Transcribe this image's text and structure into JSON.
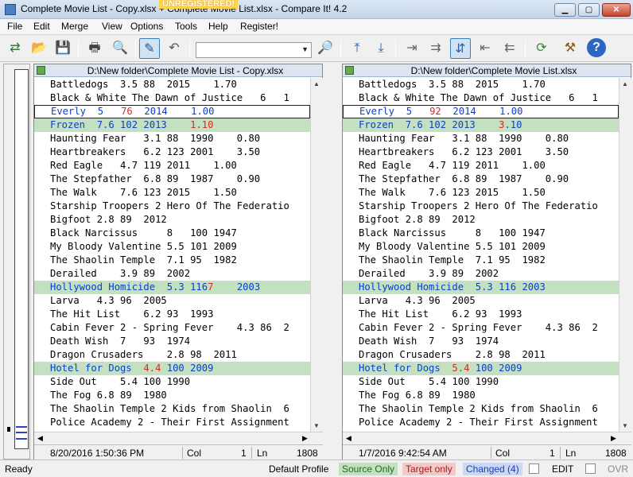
{
  "window": {
    "title": "Complete Movie List - Copy.xlsx + Complete Movie List.xlsx - Compare It! 4.2",
    "unregistered": "UNREGISTERED!",
    "min_glyph": "▁",
    "max_glyph": "▢",
    "close_glyph": "✕"
  },
  "menu": [
    "File",
    "Edit",
    "Merge",
    "View",
    "Options",
    "Tools",
    "Help",
    "Register!"
  ],
  "toolbar": {
    "search_value": "",
    "combo_arrow": "▼",
    "buttons": [
      {
        "icon": "compare-icon",
        "glyph": "⇄"
      },
      {
        "icon": "open-folder-icon",
        "glyph": "📂"
      },
      {
        "icon": "save-icon",
        "glyph": "💾"
      },
      {
        "icon": "print-icon",
        "glyph": "🖶"
      },
      {
        "icon": "print-preview-icon",
        "glyph": "🔍"
      },
      {
        "icon": "edit-pencil-icon",
        "glyph": "✎"
      },
      {
        "icon": "undo-icon",
        "glyph": "↶"
      },
      {
        "icon": "find-icon",
        "glyph": "🔎"
      },
      {
        "icon": "first-change-icon",
        "glyph": "⤒"
      },
      {
        "icon": "last-change-icon",
        "glyph": "⤓"
      },
      {
        "icon": "copy-right-icon",
        "glyph": "⇥"
      },
      {
        "icon": "copy-all-right-icon",
        "glyph": "⇉"
      },
      {
        "icon": "next-change-icon",
        "glyph": "⇵"
      },
      {
        "icon": "copy-left-icon",
        "glyph": "⇤"
      },
      {
        "icon": "copy-all-left-icon",
        "glyph": "⇇"
      },
      {
        "icon": "refresh-icon",
        "glyph": "⟳"
      },
      {
        "icon": "tools-icon",
        "glyph": "⚒"
      },
      {
        "icon": "help-icon",
        "glyph": "?"
      }
    ]
  },
  "overview": {
    "marks": [
      0.94,
      0.955,
      0.97
    ]
  },
  "left_pane": {
    "path": "D:\\New folder\\Complete Movie List - Copy.xlsx",
    "status": {
      "date": "8/20/2016 1:50:36 PM",
      "col_label": "Col",
      "col": "1",
      "ln_label": "Ln",
      "ln": "1808"
    },
    "lines": [
      {
        "segments": [
          {
            "text": "Battledogs  3.5 88  2015    1.70",
            "diff": false
          }
        ],
        "state": "normal"
      },
      {
        "segments": [
          {
            "text": "Black & White The Dawn of Justice   6   1",
            "diff": false
          }
        ],
        "state": "normal"
      },
      {
        "segments": [
          {
            "text": "Everly  5   ",
            "diff": false
          },
          {
            "text": "76",
            "diff": true
          },
          {
            "text": "  2014    1.00",
            "diff": false
          }
        ],
        "state": "focused"
      },
      {
        "segments": [
          {
            "text": "Frozen  7.6 102 2013    ",
            "diff": false
          },
          {
            "text": "1.10",
            "diff": true
          }
        ],
        "state": "changed"
      },
      {
        "segments": [
          {
            "text": "Haunting Fear   3.1 88  1990    0.80",
            "diff": false
          }
        ],
        "state": "normal"
      },
      {
        "segments": [
          {
            "text": "Heartbreakers   6.2 123 2001    3.50",
            "diff": false
          }
        ],
        "state": "normal"
      },
      {
        "segments": [
          {
            "text": "Red Eagle   4.7 119 2011    1.00",
            "diff": false
          }
        ],
        "state": "normal"
      },
      {
        "segments": [
          {
            "text": "The Stepfather  6.8 89  1987    0.90",
            "diff": false
          }
        ],
        "state": "normal"
      },
      {
        "segments": [
          {
            "text": "The Walk    7.6 123 2015    1.50",
            "diff": false
          }
        ],
        "state": "normal"
      },
      {
        "segments": [
          {
            "text": "Starship Troopers 2 Hero Of The Federatio",
            "diff": false
          }
        ],
        "state": "normal"
      },
      {
        "segments": [
          {
            "text": "Bigfoot 2.8 89  2012",
            "diff": false
          }
        ],
        "state": "normal"
      },
      {
        "segments": [
          {
            "text": "Black Narcissus     8   100 1947",
            "diff": false
          }
        ],
        "state": "normal"
      },
      {
        "segments": [
          {
            "text": "My Bloody Valentine 5.5 101 2009",
            "diff": false
          }
        ],
        "state": "normal"
      },
      {
        "segments": [
          {
            "text": "The Shaolin Temple  7.1 95  1982",
            "diff": false
          }
        ],
        "state": "normal"
      },
      {
        "segments": [
          {
            "text": "Derailed    3.9 89  2002",
            "diff": false
          }
        ],
        "state": "normal"
      },
      {
        "segments": [
          {
            "text": "Hollywood Homicide  5.3 116",
            "diff": false
          },
          {
            "text": "7",
            "diff": true
          },
          {
            "text": "    2003",
            "diff": false
          }
        ],
        "state": "changed"
      },
      {
        "segments": [
          {
            "text": "Larva   4.3 96  2005",
            "diff": false
          }
        ],
        "state": "normal"
      },
      {
        "segments": [
          {
            "text": "The Hit List    6.2 93  1993",
            "diff": false
          }
        ],
        "state": "normal"
      },
      {
        "segments": [
          {
            "text": "Cabin Fever 2 - Spring Fever    4.3 86  2",
            "diff": false
          }
        ],
        "state": "normal"
      },
      {
        "segments": [
          {
            "text": "Death Wish  7   93  1974",
            "diff": false
          }
        ],
        "state": "normal"
      },
      {
        "segments": [
          {
            "text": "Dragon Crusaders    2.8 98  2011",
            "diff": false
          }
        ],
        "state": "normal"
      },
      {
        "segments": [
          {
            "text": "Hotel for Dogs  ",
            "diff": false
          },
          {
            "text": "4.4",
            "diff": true
          },
          {
            "text": " 100 2009",
            "diff": false
          }
        ],
        "state": "changed"
      },
      {
        "segments": [
          {
            "text": "Side Out    5.4 100 1990",
            "diff": false
          }
        ],
        "state": "normal"
      },
      {
        "segments": [
          {
            "text": "The Fog 6.8 89  1980",
            "diff": false
          }
        ],
        "state": "normal"
      },
      {
        "segments": [
          {
            "text": "The Shaolin Temple 2 Kids from Shaolin  6",
            "diff": false
          }
        ],
        "state": "normal"
      },
      {
        "segments": [
          {
            "text": "Police Academy 2 - Their First Assignment",
            "diff": false
          }
        ],
        "state": "normal"
      }
    ]
  },
  "right_pane": {
    "path": "D:\\New folder\\Complete Movie List.xlsx",
    "status": {
      "date": "1/7/2016 9:42:54 AM",
      "col_label": "Col",
      "col": "1",
      "ln_label": "Ln",
      "ln": "1808"
    },
    "lines": [
      {
        "segments": [
          {
            "text": "Battledogs  3.5 88  2015    1.70",
            "diff": false
          }
        ],
        "state": "normal"
      },
      {
        "segments": [
          {
            "text": "Black & White The Dawn of Justice   6   1",
            "diff": false
          }
        ],
        "state": "normal"
      },
      {
        "segments": [
          {
            "text": "Everly  5   ",
            "diff": false
          },
          {
            "text": "92",
            "diff": true
          },
          {
            "text": "  2014    1.00",
            "diff": false
          }
        ],
        "state": "focused"
      },
      {
        "segments": [
          {
            "text": "Frozen  7.6 102 2013    ",
            "diff": false
          },
          {
            "text": "3",
            "diff": true
          },
          {
            "text": ".10",
            "diff": false
          }
        ],
        "state": "changed"
      },
      {
        "segments": [
          {
            "text": "Haunting Fear   3.1 88  1990    0.80",
            "diff": false
          }
        ],
        "state": "normal"
      },
      {
        "segments": [
          {
            "text": "Heartbreakers   6.2 123 2001    3.50",
            "diff": false
          }
        ],
        "state": "normal"
      },
      {
        "segments": [
          {
            "text": "Red Eagle   4.7 119 2011    1.00",
            "diff": false
          }
        ],
        "state": "normal"
      },
      {
        "segments": [
          {
            "text": "The Stepfather  6.8 89  1987    0.90",
            "diff": false
          }
        ],
        "state": "normal"
      },
      {
        "segments": [
          {
            "text": "The Walk    7.6 123 2015    1.50",
            "diff": false
          }
        ],
        "state": "normal"
      },
      {
        "segments": [
          {
            "text": "Starship Troopers 2 Hero Of The Federatio",
            "diff": false
          }
        ],
        "state": "normal"
      },
      {
        "segments": [
          {
            "text": "Bigfoot 2.8 89  2012",
            "diff": false
          }
        ],
        "state": "normal"
      },
      {
        "segments": [
          {
            "text": "Black Narcissus     8   100 1947",
            "diff": false
          }
        ],
        "state": "normal"
      },
      {
        "segments": [
          {
            "text": "My Bloody Valentine 5.5 101 2009",
            "diff": false
          }
        ],
        "state": "normal"
      },
      {
        "segments": [
          {
            "text": "The Shaolin Temple  7.1 95  1982",
            "diff": false
          }
        ],
        "state": "normal"
      },
      {
        "segments": [
          {
            "text": "Derailed    3.9 89  2002",
            "diff": false
          }
        ],
        "state": "normal"
      },
      {
        "segments": [
          {
            "text": "Hollywood Homicide  5.3 116 2003",
            "diff": false
          }
        ],
        "state": "changed"
      },
      {
        "segments": [
          {
            "text": "Larva   4.3 96  2005",
            "diff": false
          }
        ],
        "state": "normal"
      },
      {
        "segments": [
          {
            "text": "The Hit List    6.2 93  1993",
            "diff": false
          }
        ],
        "state": "normal"
      },
      {
        "segments": [
          {
            "text": "Cabin Fever 2 - Spring Fever    4.3 86  2",
            "diff": false
          }
        ],
        "state": "normal"
      },
      {
        "segments": [
          {
            "text": "Death Wish  7   93  1974",
            "diff": false
          }
        ],
        "state": "normal"
      },
      {
        "segments": [
          {
            "text": "Dragon Crusaders    2.8 98  2011",
            "diff": false
          }
        ],
        "state": "normal"
      },
      {
        "segments": [
          {
            "text": "Hotel for Dogs  ",
            "diff": false
          },
          {
            "text": "5.4",
            "diff": true
          },
          {
            "text": " 100 2009",
            "diff": false
          }
        ],
        "state": "changed"
      },
      {
        "segments": [
          {
            "text": "Side Out    5.4 100 1990",
            "diff": false
          }
        ],
        "state": "normal"
      },
      {
        "segments": [
          {
            "text": "The Fog 6.8 89  1980",
            "diff": false
          }
        ],
        "state": "normal"
      },
      {
        "segments": [
          {
            "text": "The Shaolin Temple 2 Kids from Shaolin  6",
            "diff": false
          }
        ],
        "state": "normal"
      },
      {
        "segments": [
          {
            "text": "Police Academy 2 - Their First Assignment",
            "diff": false
          }
        ],
        "state": "normal"
      }
    ]
  },
  "scroll": {
    "up": "▲",
    "down": "▼",
    "left": "◀",
    "right": "▶"
  },
  "statusbar": {
    "ready": "Ready",
    "profile": "Default Profile",
    "source_only": "Source Only",
    "target_only": "Target only",
    "changed": "Changed (4)",
    "edit": "EDIT",
    "ovr": "OVR"
  },
  "colors": {
    "changed_bg": "#c3e0c0",
    "changed_text": "#0c3fcb",
    "diff_text": "#d62b1f"
  }
}
